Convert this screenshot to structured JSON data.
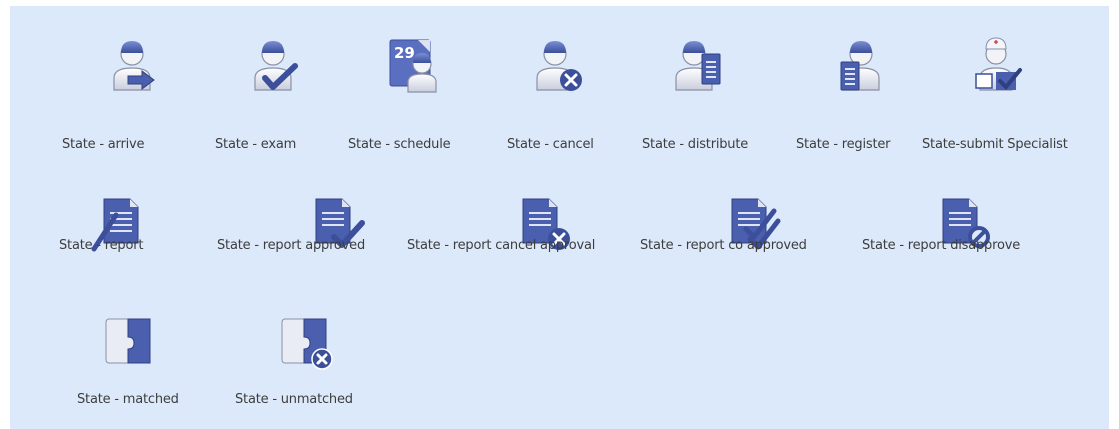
{
  "icons": [
    {
      "label": "State - arrive",
      "icon": "person-arrive-icon"
    },
    {
      "label": "State - exam",
      "icon": "person-exam-icon"
    },
    {
      "label": "State - schedule",
      "icon": "calendar-person-icon",
      "calendar_day": "29"
    },
    {
      "label": "State - cancel",
      "icon": "person-cancel-icon"
    },
    {
      "label": "State - distribute",
      "icon": "person-distribute-icon"
    },
    {
      "label": "State - register",
      "icon": "person-register-icon"
    },
    {
      "label": "State-submit Specialist",
      "icon": "specialist-submit-icon"
    },
    {
      "label": "State - report",
      "icon": "report-icon"
    },
    {
      "label": "State - report approved",
      "icon": "report-approved-icon"
    },
    {
      "label": "State - report cancel approval",
      "icon": "report-cancel-approval-icon"
    },
    {
      "label": "State - report co approved",
      "icon": "report-co-approved-icon"
    },
    {
      "label": "State - report disapprove",
      "icon": "report-disapprove-icon"
    },
    {
      "label": "State - matched",
      "icon": "puzzle-matched-icon"
    },
    {
      "label": "State - unmatched",
      "icon": "puzzle-unmatched-icon"
    }
  ],
  "colors": {
    "panel_bg": "#dce9fb",
    "icon_dark": "#3b4f9a",
    "icon_mid": "#6b7fc4",
    "icon_light": "#e9ecf5",
    "label_text": "#3d3d3d"
  }
}
